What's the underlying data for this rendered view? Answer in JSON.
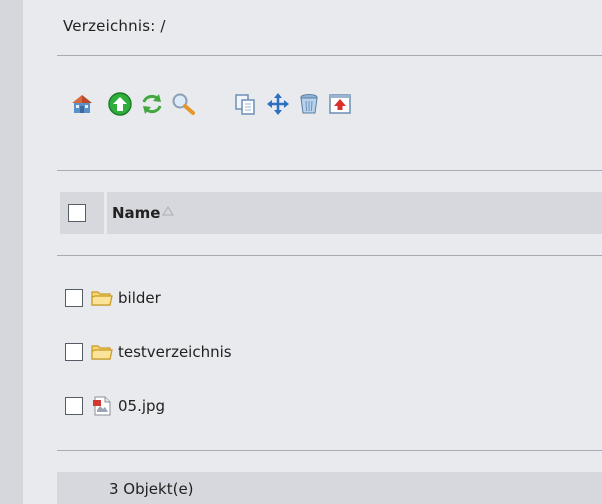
{
  "directory": {
    "label": "Verzeichnis: /"
  },
  "toolbar": {
    "buttons": [
      {
        "icon": "home-icon"
      },
      {
        "icon": "up-arrow-icon"
      },
      {
        "icon": "refresh-icon"
      },
      {
        "icon": "search-icon"
      },
      {
        "icon": "copy-icon"
      },
      {
        "icon": "move-icon"
      },
      {
        "icon": "trash-icon"
      },
      {
        "icon": "upload-icon"
      }
    ]
  },
  "table": {
    "name_header": "Name",
    "sort_indicator": "ascending",
    "rows": [
      {
        "name": "bilder",
        "type": "folder"
      },
      {
        "name": "testverzeichnis",
        "type": "folder"
      },
      {
        "name": "05.jpg",
        "type": "image-file"
      }
    ]
  },
  "footer": {
    "count": "3 Objekt(e)"
  },
  "colors": {
    "background": "#e9eaee",
    "header_background": "#d7d8dd",
    "rule": "#a9abb2",
    "left_strip": "#d6d7dc"
  }
}
